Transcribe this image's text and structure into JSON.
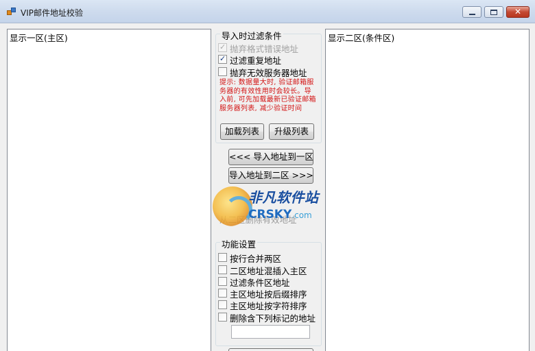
{
  "window": {
    "title": "VIP邮件地址校验",
    "controls": {
      "minimize": "minimize",
      "maximize": "maximize",
      "close": "✕"
    }
  },
  "list_main": {
    "label": "显示一区(主区)"
  },
  "list_cond": {
    "label": "显示二区(条件区)"
  },
  "import_filter": {
    "title": "导入时过滤条件",
    "options": [
      {
        "label": "抛弃格式错误地址",
        "checked": true,
        "enabled": false
      },
      {
        "label": "过滤重复地址",
        "checked": true,
        "enabled": true
      },
      {
        "label": "抛弃无效服务器地址",
        "checked": false,
        "enabled": true
      }
    ],
    "hint": "提示: 数据量大时, 验证邮箱服务器的有效性用时会较长。导入前, 可先加载最新已验证邮箱服务器列表, 减少验证时间",
    "load_button": "加载列表",
    "upgrade_button": "升级列表"
  },
  "actions": {
    "import_main": "<<< 导入地址到一区",
    "import_cond": "导入地址到二区 >>>"
  },
  "ghost_text": "从二区删除有效地址",
  "watermark": {
    "cn": "非凡软件站",
    "en": "CRSKY",
    "com": ".com"
  },
  "functions": {
    "title": "功能设置",
    "options": [
      {
        "label": "按行合并两区",
        "checked": false
      },
      {
        "label": "二区地址混插入主区",
        "checked": false
      },
      {
        "label": "过滤条件区地址",
        "checked": false
      },
      {
        "label": "主区地址按后缀排序",
        "checked": false
      },
      {
        "label": "主区地址按字符排序",
        "checked": false
      },
      {
        "label": "删除含下列标记的地址",
        "checked": false
      }
    ],
    "marker_value": ""
  },
  "bottom_button": ""
}
